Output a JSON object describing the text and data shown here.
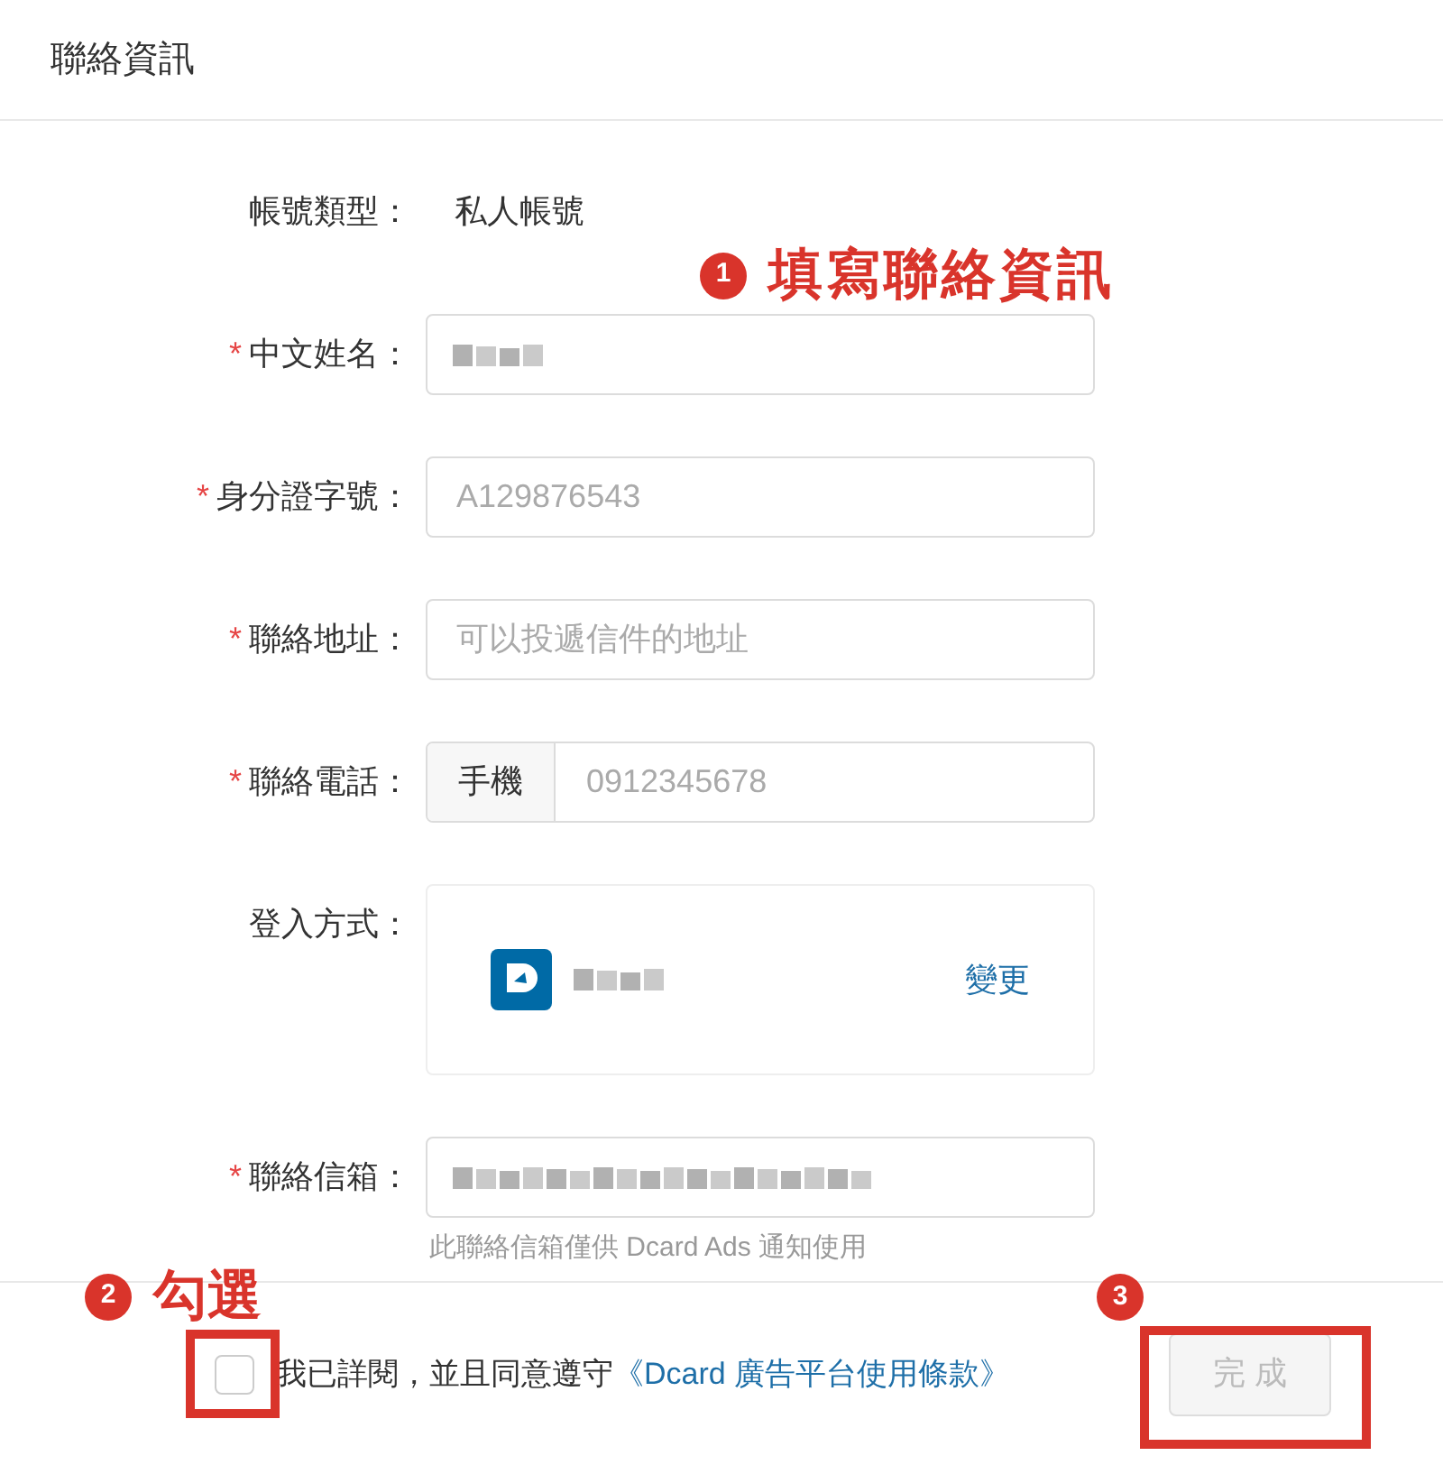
{
  "header": {
    "title": "聯絡資訊"
  },
  "fields": [
    {
      "kind": "static",
      "label": "帳號類型：",
      "value": "私人帳號"
    },
    {
      "kind": "name",
      "label": "中文姓名：",
      "required_mark": "*"
    },
    {
      "kind": "input",
      "label": "身分證字號：",
      "required_mark": "*",
      "placeholder": "A129876543"
    },
    {
      "kind": "input",
      "label": "聯絡地址：",
      "required_mark": "*",
      "placeholder": "可以投遞信件的地址"
    },
    {
      "kind": "phone",
      "label": "聯絡電話：",
      "required_mark": "*",
      "prefix": "手機",
      "placeholder": "0912345678"
    },
    {
      "kind": "login",
      "label": "登入方式：",
      "action": "變更"
    },
    {
      "kind": "email",
      "label": "聯絡信箱：",
      "required_mark": "*",
      "hint": "此聯絡信箱僅供 Dcard Ads 通知使用"
    }
  ],
  "agreement": {
    "checked": false,
    "text": "我已詳閱，並且同意遵守",
    "link": "《Dcard 廣告平台使用條款》"
  },
  "submit": {
    "label": "完 成",
    "disabled": true
  },
  "annotations": [
    {
      "number": "1",
      "text": "填寫聯絡資訊"
    },
    {
      "number": "2",
      "text": "勾選"
    },
    {
      "number": "3"
    }
  ]
}
